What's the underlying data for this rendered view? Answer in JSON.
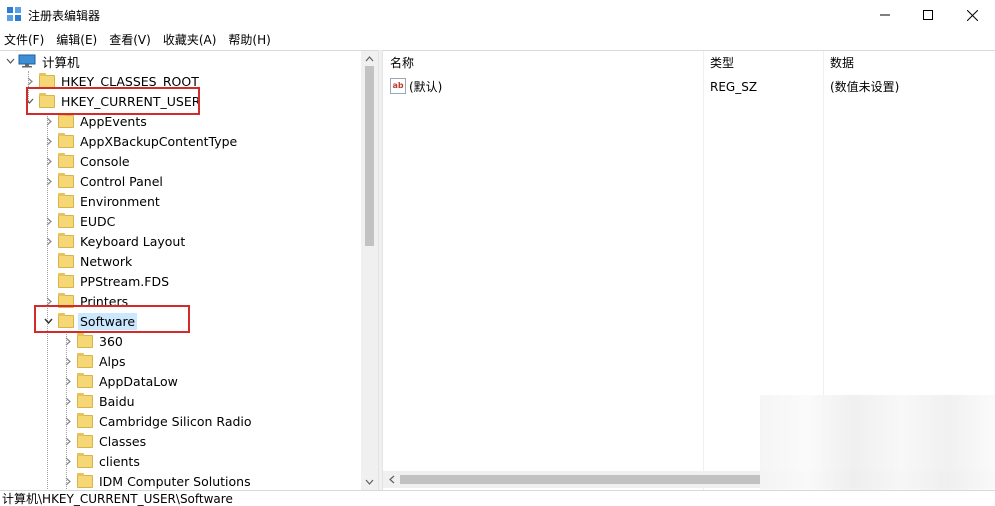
{
  "window": {
    "title": "注册表编辑器",
    "icon": "regedit-icon"
  },
  "menu": [
    "文件(F)",
    "编辑(E)",
    "查看(V)",
    "收藏夹(A)",
    "帮助(H)"
  ],
  "tree": {
    "root": "计算机",
    "items": [
      {
        "label": "HKEY_CLASSES_ROOT",
        "level": 1,
        "expander": "collapsed"
      },
      {
        "label": "HKEY_CURRENT_USER",
        "level": 1,
        "expander": "expanded",
        "highlight": true
      },
      {
        "label": "AppEvents",
        "level": 2,
        "expander": "collapsed"
      },
      {
        "label": "AppXBackupContentType",
        "level": 2,
        "expander": "collapsed"
      },
      {
        "label": "Console",
        "level": 2,
        "expander": "collapsed"
      },
      {
        "label": "Control Panel",
        "level": 2,
        "expander": "collapsed"
      },
      {
        "label": "Environment",
        "level": 2,
        "expander": "none"
      },
      {
        "label": "EUDC",
        "level": 2,
        "expander": "collapsed"
      },
      {
        "label": "Keyboard Layout",
        "level": 2,
        "expander": "collapsed"
      },
      {
        "label": "Network",
        "level": 2,
        "expander": "none"
      },
      {
        "label": "PPStream.FDS",
        "level": 2,
        "expander": "none"
      },
      {
        "label": "Printers",
        "level": 2,
        "expander": "collapsed"
      },
      {
        "label": "Software",
        "level": 2,
        "expander": "expanded",
        "selected": true,
        "highlight": true
      },
      {
        "label": "360",
        "level": 3,
        "expander": "collapsed"
      },
      {
        "label": "Alps",
        "level": 3,
        "expander": "collapsed"
      },
      {
        "label": "AppDataLow",
        "level": 3,
        "expander": "collapsed"
      },
      {
        "label": "Baidu",
        "level": 3,
        "expander": "collapsed"
      },
      {
        "label": "Cambridge Silicon Radio",
        "level": 3,
        "expander": "collapsed"
      },
      {
        "label": "Classes",
        "level": 3,
        "expander": "collapsed"
      },
      {
        "label": "clients",
        "level": 3,
        "expander": "collapsed"
      },
      {
        "label": "IDM Computer Solutions",
        "level": 3,
        "expander": "collapsed"
      }
    ]
  },
  "list": {
    "columns": [
      "名称",
      "类型",
      "数据"
    ],
    "rows": [
      {
        "name": "(默认)",
        "type": "REG_SZ",
        "data": "(数值未设置)",
        "icon": "string-value-icon"
      }
    ]
  },
  "status": {
    "path": "计算机\\HKEY_CURRENT_USER\\Software"
  },
  "colors": {
    "highlight_box": "#d22b2b",
    "selection": "#cce8ff",
    "folder": "#f5d776"
  }
}
